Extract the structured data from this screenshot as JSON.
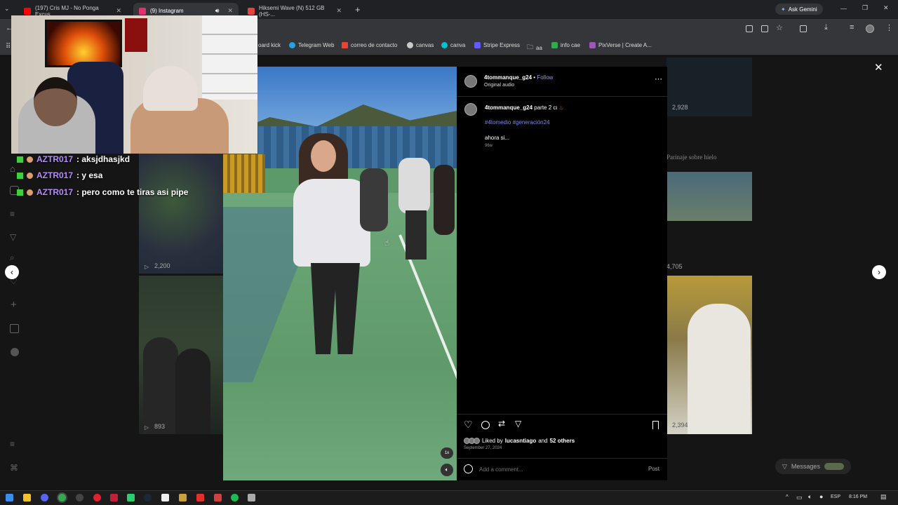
{
  "tabs": [
    {
      "title": "(197) Cris MJ - No Ponga Excus...",
      "icon": "youtube-icon",
      "color": "#ff0000"
    },
    {
      "title": "(9) Instagram",
      "icon": "instagram-icon",
      "color": "#e1306c"
    },
    {
      "title": "Hiksemi Wave (N) 512 GB (HS-...",
      "icon": "store-icon",
      "color": "#e94040"
    }
  ],
  "ask_gemini": "Ask Gemini",
  "bookmarks": [
    {
      "label": "oard kick",
      "color": "#53fc18"
    },
    {
      "label": "Telegram Web",
      "color": "#2aa1da"
    },
    {
      "label": "correo de contacto",
      "color": "#ea4335"
    },
    {
      "label": "canvas",
      "color": "#c9c9c9"
    },
    {
      "label": "canva",
      "color": "#00c4cc"
    },
    {
      "label": "Stripe Express",
      "color": "#635bff"
    },
    {
      "label": "aa",
      "color": "#bbbbbb"
    },
    {
      "label": "info cae",
      "color": "#34a853"
    },
    {
      "label": "PixVerse | Create A...",
      "color": "#9b59b6"
    }
  ],
  "chat": [
    {
      "user": "AZTR017",
      "msg": ": aksjdhasjkd"
    },
    {
      "user": "AZTR017",
      "msg": ": y esa"
    },
    {
      "user": "AZTR017",
      "msg": ": pero como te tiras asi pipe"
    }
  ],
  "post": {
    "username": "4tommanque_g24",
    "follow": "Follow",
    "audio": "Original audio",
    "caption_user": "4tommanque_g24",
    "caption_text": "parte 2 cι",
    "hashtags": "#4tomedio #generación24",
    "comment": "ahora si...",
    "age": "96w",
    "liked_by_prefix": "Liked by",
    "liked_by_user": "lucasntiago",
    "liked_and": "and",
    "liked_others": "52 others",
    "date": "September 27, 2024",
    "comment_placeholder": "Add a comment...",
    "post_button": "Post",
    "speed_label": "1x"
  },
  "grid_counts": {
    "c1": "2,200",
    "c2": "893",
    "c3": "2,928",
    "c4": "4,705",
    "c5": "2,394",
    "caption_right": "Parinaje sobre hielo"
  },
  "messages_label": "Messages",
  "tray": {
    "lang": "ESP",
    "time": "8:16 PM"
  }
}
